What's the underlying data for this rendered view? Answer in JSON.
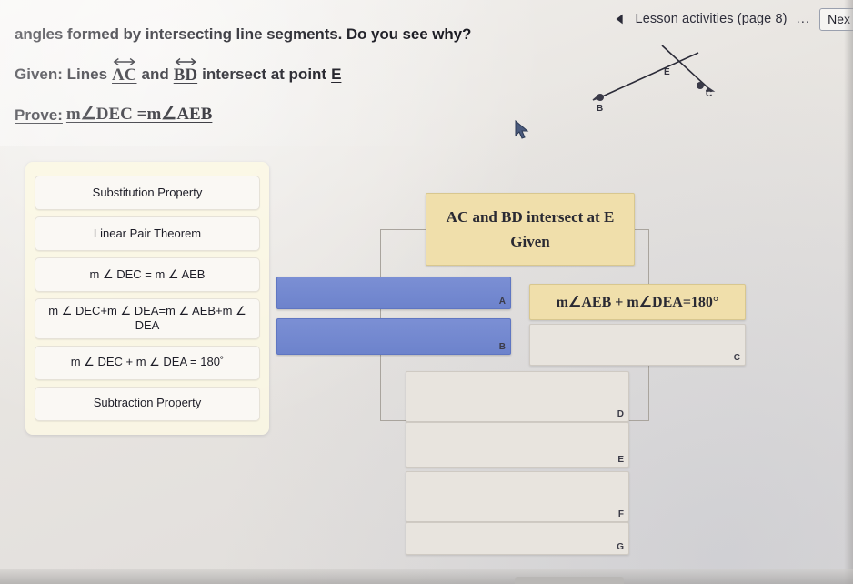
{
  "header": {
    "prev_icon": "previous-triangle-icon",
    "lesson_label": "Lesson activities (page 8)",
    "menu_ellipsis": "...",
    "next_label": "Nex"
  },
  "statement": {
    "line1": "angles formed by intersecting line segments. Do you see why?",
    "given_prefix": "Given: Lines",
    "line_ac": "AC",
    "given_and": "and",
    "line_bd": "BD",
    "given_suffix": "intersect at point",
    "point_e": "E",
    "prove_prefix": "Prove:",
    "prove_statement": "m∠DEC =m∠AEB"
  },
  "figure": {
    "labels": [
      "E",
      "B",
      "C"
    ],
    "description": "two intersecting lines through point E"
  },
  "bank": {
    "items": [
      {
        "id": "substitution-property",
        "text": "Substitution Property"
      },
      {
        "id": "linear-pair-theorem",
        "text": "Linear Pair Theorem"
      },
      {
        "id": "m-dec-eq-m-aeb",
        "text": "m ∠ DEC = m ∠ AEB"
      },
      {
        "id": "sum-equality",
        "text": "m ∠ DEC+m ∠ DEA=m ∠ AEB+m ∠ DEA"
      },
      {
        "id": "dec-plus-dea-180",
        "text": "m ∠ DEC + m ∠ DEA = 180˚"
      },
      {
        "id": "subtraction-property",
        "text": "Subtraction Property"
      }
    ]
  },
  "flow": {
    "given_line1": "AC and BD intersect at E",
    "given_line2": "Given",
    "aeb_box_text": "m∠AEB + m∠DEA=180°",
    "slots": [
      {
        "letter": "A",
        "state": "filled"
      },
      {
        "letter": "B",
        "state": "filled"
      },
      {
        "letter": "C",
        "state": "empty"
      },
      {
        "letter": "D",
        "state": "empty"
      },
      {
        "letter": "E",
        "state": "empty"
      },
      {
        "letter": "F",
        "state": "empty"
      },
      {
        "letter": "G",
        "state": "empty"
      }
    ]
  },
  "colors": {
    "given_fill": "#f0dfab",
    "slot_filled": "#6d83cc",
    "slot_blue": "#b6c2e2",
    "slot_empty": "#e8e4de",
    "bank_bg": "#fdf9e4"
  }
}
